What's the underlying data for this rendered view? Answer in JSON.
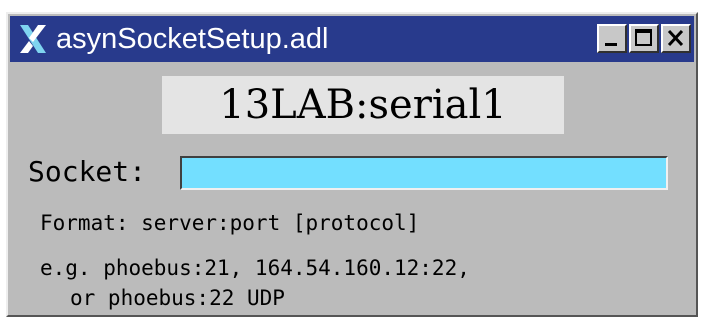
{
  "window": {
    "title": "asynSocketSetup.adl",
    "icon": "x-logo-icon"
  },
  "controls": {
    "minimize": "minimize-icon",
    "maximize": "maximize-icon",
    "close": "close-icon"
  },
  "device": {
    "name": "13LAB:serial1"
  },
  "socket": {
    "label": "Socket:",
    "value": ""
  },
  "help": {
    "format": "Format: server:port [protocol]",
    "example_line1": "e.g. phoebus:21, 164.54.160.12:22,",
    "example_line2": "or phoebus:22 UDP"
  },
  "colors": {
    "titlebar": "#283a8c",
    "window_bg": "#bbbbbb",
    "device_box_bg": "#e4e4e4",
    "input_bg": "#73dfff"
  }
}
